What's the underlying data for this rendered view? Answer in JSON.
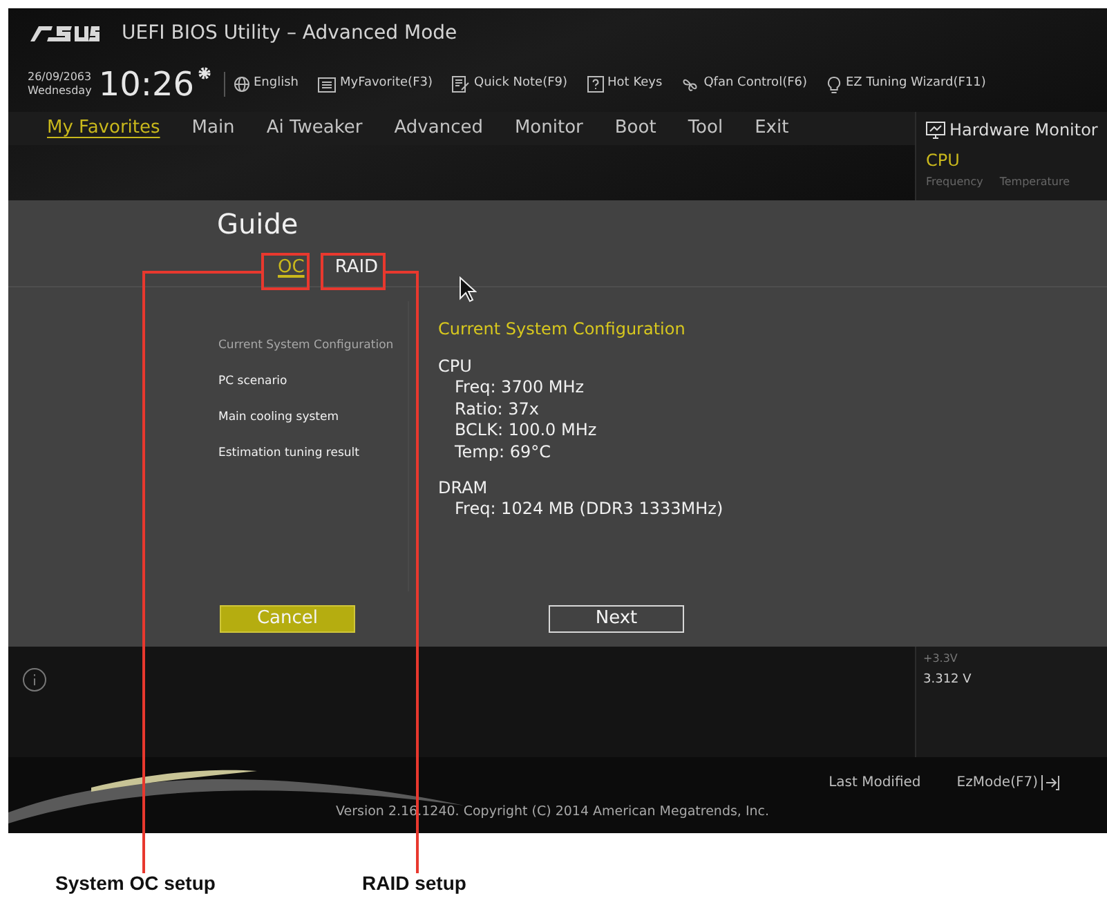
{
  "title_bar": {
    "title": "UEFI BIOS Utility – Advanced Mode"
  },
  "toolbar": {
    "date": "26/09/2063",
    "day": "Wednesday",
    "time": "10:26",
    "items": [
      {
        "label": "English"
      },
      {
        "label": "MyFavorite(F3)"
      },
      {
        "label": "Quick Note(F9)"
      },
      {
        "label": "Hot Keys"
      },
      {
        "label": "Qfan Control(F6)"
      },
      {
        "label": "EZ Tuning Wizard(F11)"
      }
    ]
  },
  "nav_tabs": [
    {
      "label": "My Favorites",
      "selected": true
    },
    {
      "label": "Main",
      "selected": false
    },
    {
      "label": "Ai Tweaker",
      "selected": false
    },
    {
      "label": "Advanced",
      "selected": false
    },
    {
      "label": "Monitor",
      "selected": false
    },
    {
      "label": "Boot",
      "selected": false
    },
    {
      "label": "Tool",
      "selected": false
    },
    {
      "label": "Exit",
      "selected": false
    }
  ],
  "hardware_monitor": {
    "title": "Hardware Monitor",
    "section": "CPU",
    "columns": [
      "Frequency",
      "Temperature"
    ],
    "reading_label": "+3.3V",
    "reading_value": "3.312 V"
  },
  "guide": {
    "title": "Guide",
    "tabs": [
      {
        "label": "OC",
        "selected": true
      },
      {
        "label": "RAID",
        "selected": false
      }
    ],
    "steps": [
      {
        "label": "Current System Configuration",
        "selected": true
      },
      {
        "label": "PC scenario",
        "selected": false
      },
      {
        "label": "Main cooling system",
        "selected": false
      },
      {
        "label": "Estimation tuning result",
        "selected": false
      }
    ],
    "heading": "Current System Configuration",
    "groups": [
      {
        "name": "CPU",
        "lines": [
          "Freq: 3700 MHz",
          "Ratio: 37x",
          "BCLK: 100.0 MHz",
          "Temp: 69°C"
        ]
      },
      {
        "name": "DRAM",
        "lines": [
          "Freq: 1024 MB (DDR3 1333MHz)"
        ]
      }
    ],
    "buttons": [
      {
        "label": "Cancel",
        "kind": "primary"
      },
      {
        "label": "Next",
        "kind": "outline"
      }
    ]
  },
  "footer": {
    "last_modified": "Last Modified",
    "ez_mode": "EzMode(F7)",
    "version": "Version 2.16.1240. Copyright (C) 2014 American Megatrends, Inc."
  },
  "callouts": [
    {
      "label": "System OC setup"
    },
    {
      "label": "RAID setup"
    }
  ]
}
